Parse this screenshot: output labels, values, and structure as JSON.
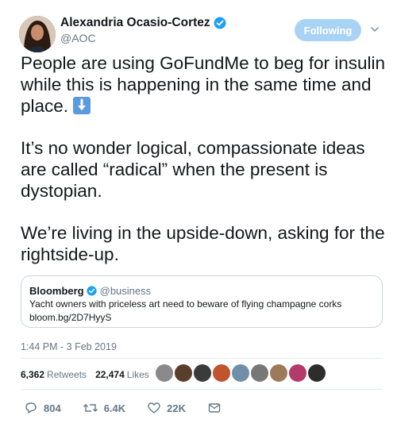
{
  "author": {
    "name": "Alexandria Ocasio-Cortez",
    "handle": "@AOC",
    "follow_label": "Following"
  },
  "tweet": {
    "paragraphs": [
      "People are using GoFundMe to beg for insulin while this is happening in the same time and place.",
      "It’s no wonder logical, compassionate ideas are called “radical” when the present is dystopian.",
      "We’re living in the upside-down, asking for the rightside-up."
    ]
  },
  "quoted_tweet": {
    "name": "Bloomberg",
    "handle": "@business",
    "text": "Yacht owners with priceless art need to beware of flying champagne corks",
    "link": "bloom.bg/2D7HyyS"
  },
  "timestamp": "1:44 PM - 3 Feb 2019",
  "stats": {
    "retweets_count": "6,362",
    "retweets_label": "Retweets",
    "likes_count": "22,474",
    "likes_label": "Likes"
  },
  "actions": {
    "replies": "804",
    "retweets": "6.4K",
    "likes": "22K"
  },
  "colors": {
    "verified": "#1da1f2",
    "follow_button": "#a9d3f5",
    "secondary_text": "#657786",
    "border": "#ccd6dd"
  }
}
